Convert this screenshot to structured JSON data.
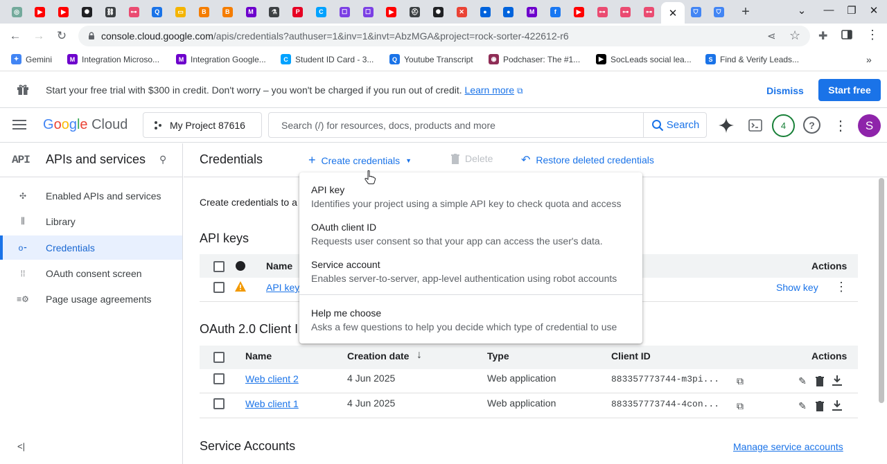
{
  "browser": {
    "tabs": [
      {
        "icon": "chatgpt-icon",
        "color": "#74aa9c",
        "glyph": "◎"
      },
      {
        "icon": "youtube-icon",
        "color": "#ff0000",
        "glyph": "▶"
      },
      {
        "icon": "youtube-icon",
        "color": "#ff0000",
        "glyph": "▶"
      },
      {
        "icon": "openai-icon",
        "color": "#202124",
        "glyph": "✺"
      },
      {
        "icon": "link-icon",
        "color": "#3c4043",
        "glyph": "⛓"
      },
      {
        "icon": "n8n-icon",
        "color": "#ea4b71",
        "glyph": "⊶"
      },
      {
        "icon": "circle-q-icon",
        "color": "#1a73e8",
        "glyph": "Q"
      },
      {
        "icon": "google-slides-icon",
        "color": "#f4b400",
        "glyph": "▭"
      },
      {
        "icon": "blogger-icon",
        "color": "#f57d00",
        "glyph": "B"
      },
      {
        "icon": "blogger-icon",
        "color": "#f57d00",
        "glyph": "B"
      },
      {
        "icon": "make-icon",
        "color": "#6d00cc",
        "glyph": "M"
      },
      {
        "icon": "flask-icon",
        "color": "#3c4043",
        "glyph": "⚗"
      },
      {
        "icon": "pinterest-icon",
        "color": "#e60023",
        "glyph": "P"
      },
      {
        "icon": "circle-c-icon",
        "color": "#00a2ff",
        "glyph": "C"
      },
      {
        "icon": "chat-bubble-icon",
        "color": "#7b3fe4",
        "glyph": "☐"
      },
      {
        "icon": "chat-bubble-icon",
        "color": "#7b3fe4",
        "glyph": "☐"
      },
      {
        "icon": "youtube-icon",
        "color": "#ff0000",
        "glyph": "▶"
      },
      {
        "icon": "hat-icon",
        "color": "#3c4043",
        "glyph": "⛑"
      },
      {
        "icon": "openai-icon",
        "color": "#202124",
        "glyph": "✺"
      },
      {
        "icon": "tools-icon",
        "color": "#ea4335",
        "glyph": "✕"
      },
      {
        "icon": "flickr-icon",
        "color": "#0063dc",
        "glyph": "●"
      },
      {
        "icon": "flickr-icon",
        "color": "#0063dc",
        "glyph": "●"
      },
      {
        "icon": "make-icon",
        "color": "#6d00cc",
        "glyph": "M"
      },
      {
        "icon": "facebook-icon",
        "color": "#1877f2",
        "glyph": "f"
      },
      {
        "icon": "youtube-icon",
        "color": "#ff0000",
        "glyph": "▶"
      },
      {
        "icon": "n8n-icon",
        "color": "#ea4b71",
        "glyph": "⊶"
      },
      {
        "icon": "n8n-icon",
        "color": "#ea4b71",
        "glyph": "⊶"
      },
      {
        "icon": "n8n-icon",
        "color": "#ea4b71",
        "glyph": "⊶"
      }
    ],
    "extra_tabs": [
      {
        "icon": "shield-icon",
        "color": "#4285f4",
        "glyph": "⛉"
      },
      {
        "icon": "shield-icon",
        "color": "#4285f4",
        "glyph": "⛉"
      }
    ],
    "url_host": "console.cloud.google.com",
    "url_path": "/apis/credentials?authuser=1&inv=1&invt=AbzMGA&project=rock-sorter-422612-r6",
    "bookmarks": [
      {
        "label": "Gemini",
        "icon": "gemini-icon",
        "color": "#4285f4",
        "glyph": "✦"
      },
      {
        "label": "Integration Microso...",
        "icon": "make-icon",
        "color": "#6d00cc",
        "glyph": "M"
      },
      {
        "label": "Integration Google...",
        "icon": "make-icon",
        "color": "#6d00cc",
        "glyph": "M"
      },
      {
        "label": "Student ID Card - 3...",
        "icon": "circle-c-icon",
        "color": "#00a2ff",
        "glyph": "C"
      },
      {
        "label": "Youtube Transcript",
        "icon": "circle-q-icon",
        "color": "#1a73e8",
        "glyph": "Q"
      },
      {
        "label": "Podchaser: The #1...",
        "icon": "podchaser-icon",
        "color": "#8f2d56",
        "glyph": "◉"
      },
      {
        "label": "SocLeads social lea...",
        "icon": "socleads-icon",
        "color": "#000000",
        "glyph": "▶"
      },
      {
        "label": "Find & Verify Leads...",
        "icon": "find-leads-icon",
        "color": "#1a73e8",
        "glyph": "S"
      }
    ],
    "more_bookmarks": "»"
  },
  "banner": {
    "text": "Start your free trial with $300 in credit. Don't worry – you won't be charged if you run out of credit.",
    "learn_more": "Learn more",
    "dismiss": "Dismiss",
    "start_free": "Start free"
  },
  "header": {
    "logo_google": "Google",
    "logo_cloud": "Cloud",
    "project": "My Project 87616",
    "search_placeholder": "Search (/) for resources, docs, products and more",
    "search_button": "Search",
    "notifications": "4",
    "avatar": "S"
  },
  "sidebar": {
    "api_badge": "API",
    "title": "APIs and services",
    "items": [
      {
        "label": "Enabled APIs and services",
        "icon": "enabled-apis-icon",
        "glyph": "✣"
      },
      {
        "label": "Library",
        "icon": "library-icon",
        "glyph": "⫼"
      },
      {
        "label": "Credentials",
        "icon": "key-icon",
        "glyph": "o⁃"
      },
      {
        "label": "OAuth consent screen",
        "icon": "oauth-icon",
        "glyph": "⁞⁞"
      },
      {
        "label": "Page usage agreements",
        "icon": "settings-list-icon",
        "glyph": "≡⚙"
      }
    ],
    "collapse": "<|"
  },
  "toolbar": {
    "title": "Credentials",
    "create": "Create credentials",
    "delete": "Delete",
    "restore": "Restore deleted credentials"
  },
  "main": {
    "intro": "Create credentials to a",
    "api_keys_title": "API keys",
    "api_keys_headers": {
      "name": "Name",
      "actions": "Actions"
    },
    "api_keys_rows": [
      {
        "name": "API key",
        "action": "Show key"
      }
    ],
    "oauth_title": "OAuth 2.0 Client I",
    "oauth_headers": {
      "name": "Name",
      "created": "Creation date",
      "type": "Type",
      "client_id": "Client ID",
      "actions": "Actions"
    },
    "oauth_rows": [
      {
        "name": "Web client 2",
        "created": "4 Jun 2025",
        "type": "Web application",
        "client_id": "883357773744-m3pi..."
      },
      {
        "name": "Web client 1",
        "created": "4 Jun 2025",
        "type": "Web application",
        "client_id": "883357773744-4con..."
      }
    ],
    "service_accounts_title": "Service Accounts",
    "manage_service_accounts": "Manage service accounts"
  },
  "menu": {
    "items": [
      {
        "title": "API key",
        "desc": "Identifies your project using a simple API key to check quota and access"
      },
      {
        "title": "OAuth client ID",
        "desc": "Requests user consent so that your app can access the user's data."
      },
      {
        "title": "Service account",
        "desc": "Enables server-to-server, app-level authentication using robot accounts"
      },
      {
        "title": "Help me choose",
        "desc": "Asks a few questions to help you decide which type of credential to use"
      }
    ]
  },
  "colors": {
    "accent": "#1a73e8",
    "warning": "#f29900",
    "avatar": "#8e24aa",
    "notification": "#188038"
  }
}
